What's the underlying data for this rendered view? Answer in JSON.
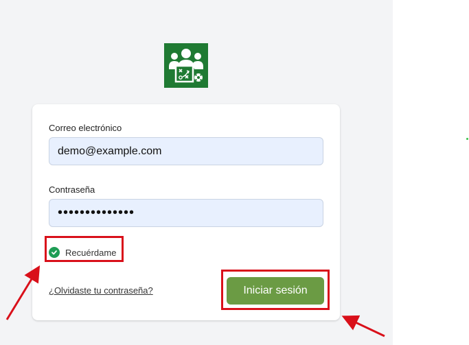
{
  "form": {
    "email_label": "Correo electrónico",
    "email_value": "demo@example.com",
    "password_label": "Contraseña",
    "password_value": "••••••••••••••",
    "remember_label": "Recuérdame",
    "remember_checked": true,
    "forgot_link": "¿Olvidaste tu contraseña?",
    "submit_label": "Iniciar sesión"
  },
  "logo": {
    "icon": "team-strategy-icon"
  },
  "colors": {
    "logo_bg": "#1f7a33",
    "submit_bg": "#6b9b44",
    "checkbox": "#1f9d55",
    "annotation": "#d9101a",
    "input_bg": "#e8f0fe"
  }
}
